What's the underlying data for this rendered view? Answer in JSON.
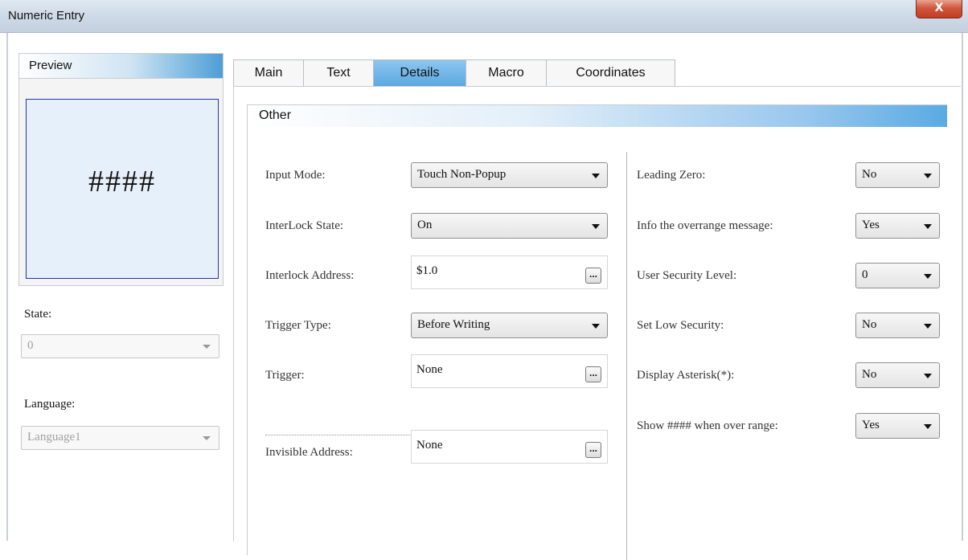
{
  "window": {
    "title": "Numeric Entry",
    "close_label": "X"
  },
  "preview": {
    "header": "Preview",
    "value": "####"
  },
  "sidebar": {
    "state_label": "State:",
    "state_value": "0",
    "language_label": "Language:",
    "language_value": "Language1"
  },
  "tabs": [
    {
      "label": "Main"
    },
    {
      "label": "Text"
    },
    {
      "label": "Details",
      "active": true
    },
    {
      "label": "Macro"
    },
    {
      "label": "Coordinates"
    }
  ],
  "group": {
    "title": "Other"
  },
  "left_fields": {
    "input_mode": {
      "label": "Input Mode:",
      "value": "Touch Non-Popup"
    },
    "interlock_state": {
      "label": "InterLock State:",
      "value": "On"
    },
    "interlock_address": {
      "label": "Interlock Address:",
      "value": "$1.0",
      "button": "..."
    },
    "trigger_type": {
      "label": "Trigger Type:",
      "value": "Before Writing"
    },
    "trigger": {
      "label": "Trigger:",
      "value": "None",
      "button": "..."
    },
    "invisible_address": {
      "label": "Invisible Address:",
      "value": "None",
      "button": "..."
    }
  },
  "right_fields": {
    "leading_zero": {
      "label": "Leading Zero:",
      "value": "No"
    },
    "info_overrange": {
      "label": "Info the overrange message:",
      "value": "Yes"
    },
    "user_security_level": {
      "label": "User Security Level:",
      "value": "0"
    },
    "set_low_security": {
      "label": "Set Low Security:",
      "value": "No"
    },
    "display_asterisk": {
      "label": "Display Asterisk(*):",
      "value": "No"
    },
    "show_over_range": {
      "label": "Show #### when over range:",
      "value": "Yes"
    }
  },
  "colors": {
    "active_tab": "#5aa8e0",
    "header_gradient_end": "#4c9ed6",
    "preview_border": "#2233aa",
    "preview_background": "#e6f0fb",
    "close_button": "#c23c22"
  },
  "icons": {
    "close": "close-icon",
    "dropdown": "chevron-down-icon",
    "browse": "ellipsis-icon"
  }
}
